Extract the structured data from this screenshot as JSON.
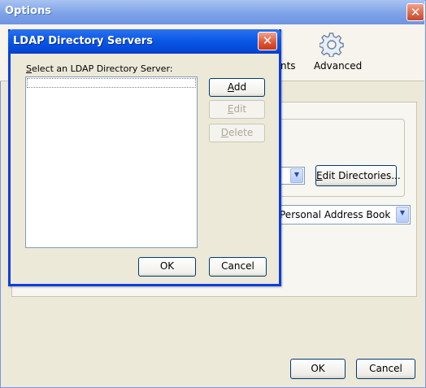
{
  "options_window": {
    "title": "Options",
    "toolbar": {
      "partial_tab_label": "nts",
      "advanced_label": "Advanced"
    },
    "directory_server_combo": {
      "value": ""
    },
    "edit_directories_button": {
      "mnemonic": "E",
      "rest": "dit Directories..."
    },
    "address_book_combo": {
      "value": "Personal Address Book"
    },
    "ok_label": "OK",
    "cancel_label": "Cancel"
  },
  "ldap_dialog": {
    "title": "LDAP Directory Servers",
    "select_label_mnemonic": "S",
    "select_label_rest": "elect an LDAP Directory Server:",
    "servers": [],
    "add": {
      "mnemonic": "A",
      "rest": "dd"
    },
    "edit": {
      "mnemonic": "E",
      "rest": "dit"
    },
    "delete": {
      "mnemonic": "D",
      "rest": "elete"
    },
    "ok_label": "OK",
    "cancel_label": "Cancel"
  },
  "colors": {
    "xp_blue_title": "#0a59e6",
    "inactive_title": "#7ea3e7",
    "window_face": "#ece9d8"
  },
  "icons": [
    "close-icon",
    "gear-icon",
    "chevron-down-icon"
  ]
}
